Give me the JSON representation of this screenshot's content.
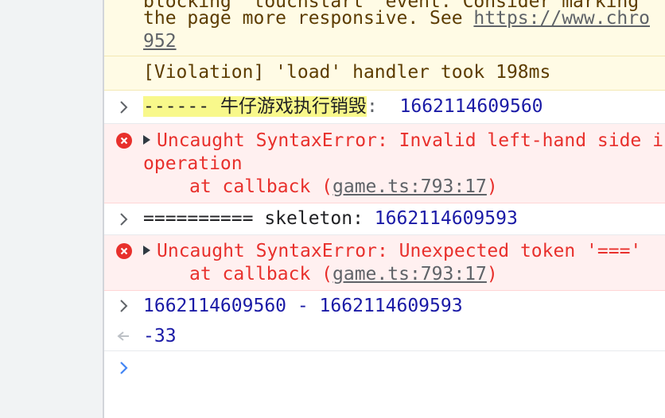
{
  "console": {
    "warn_block": {
      "line1": "blocking 'touchstart' event. Consider marking",
      "line2_prefix": "the page more responsive. See ",
      "line2_link": "https://www.chro",
      "line3": "952"
    },
    "violation": {
      "text": "[Violation] 'load' handler took 198ms"
    },
    "log1": {
      "label": "------ 牛仔游戏执行销毁",
      "sep": ":",
      "value": "1662114609560"
    },
    "error1": {
      "message": "Uncaught SyntaxError: Invalid left-hand side in assignment",
      "line2": "operation",
      "at": "at callback (",
      "link": "game.ts:793:17",
      "close": ")"
    },
    "log2": {
      "text": "========== skeleton: ",
      "value": "1662114609593"
    },
    "error2": {
      "message": "Uncaught SyntaxError: Unexpected token '==='",
      "at": "at callback (",
      "link": "game.ts:793:17",
      "close": ")"
    },
    "input": {
      "expression": "1662114609560 - 1662114609593"
    },
    "result": {
      "value": "-33"
    },
    "icons": {
      "expand": "chevron-right-icon",
      "error": "error-circle-icon",
      "result": "result-arrow-icon",
      "prompt": "prompt-chevron-icon"
    },
    "colors": {
      "error": "#e8302c",
      "number": "#1a1aa6",
      "prompt": "#4285f4",
      "warning_bg": "#fffbe5",
      "error_bg": "#fff0f0"
    }
  }
}
